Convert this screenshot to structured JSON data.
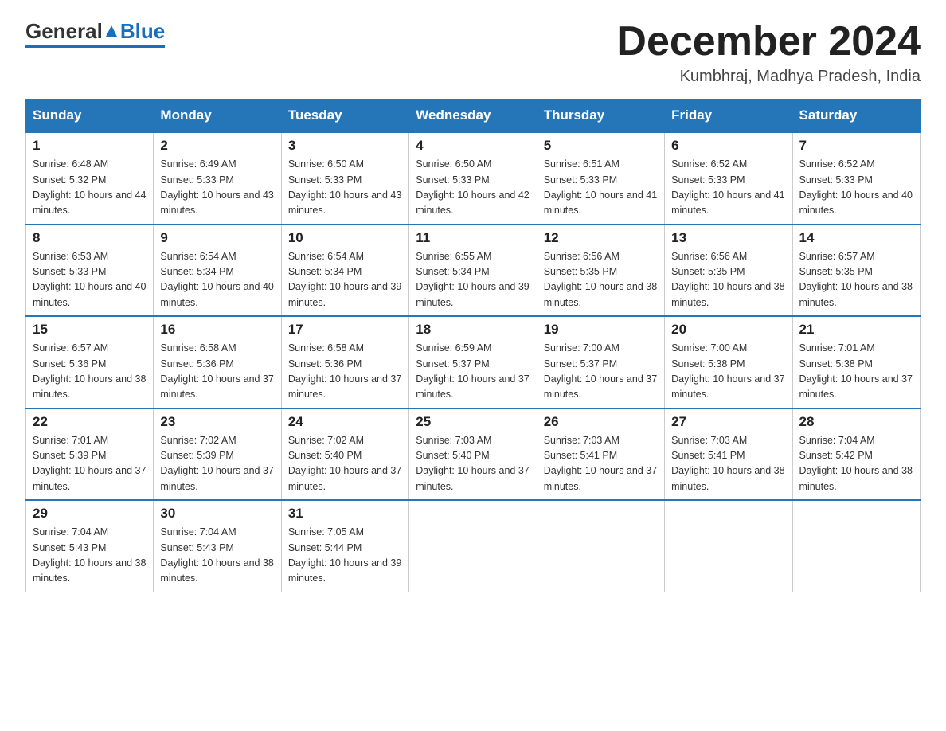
{
  "header": {
    "logo_general": "General",
    "logo_blue": "Blue",
    "title": "December 2024",
    "subtitle": "Kumbhraj, Madhya Pradesh, India"
  },
  "weekdays": [
    "Sunday",
    "Monday",
    "Tuesday",
    "Wednesday",
    "Thursday",
    "Friday",
    "Saturday"
  ],
  "weeks": [
    [
      {
        "day": "1",
        "sunrise": "6:48 AM",
        "sunset": "5:32 PM",
        "daylight": "10 hours and 44 minutes."
      },
      {
        "day": "2",
        "sunrise": "6:49 AM",
        "sunset": "5:33 PM",
        "daylight": "10 hours and 43 minutes."
      },
      {
        "day": "3",
        "sunrise": "6:50 AM",
        "sunset": "5:33 PM",
        "daylight": "10 hours and 43 minutes."
      },
      {
        "day": "4",
        "sunrise": "6:50 AM",
        "sunset": "5:33 PM",
        "daylight": "10 hours and 42 minutes."
      },
      {
        "day": "5",
        "sunrise": "6:51 AM",
        "sunset": "5:33 PM",
        "daylight": "10 hours and 41 minutes."
      },
      {
        "day": "6",
        "sunrise": "6:52 AM",
        "sunset": "5:33 PM",
        "daylight": "10 hours and 41 minutes."
      },
      {
        "day": "7",
        "sunrise": "6:52 AM",
        "sunset": "5:33 PM",
        "daylight": "10 hours and 40 minutes."
      }
    ],
    [
      {
        "day": "8",
        "sunrise": "6:53 AM",
        "sunset": "5:33 PM",
        "daylight": "10 hours and 40 minutes."
      },
      {
        "day": "9",
        "sunrise": "6:54 AM",
        "sunset": "5:34 PM",
        "daylight": "10 hours and 40 minutes."
      },
      {
        "day": "10",
        "sunrise": "6:54 AM",
        "sunset": "5:34 PM",
        "daylight": "10 hours and 39 minutes."
      },
      {
        "day": "11",
        "sunrise": "6:55 AM",
        "sunset": "5:34 PM",
        "daylight": "10 hours and 39 minutes."
      },
      {
        "day": "12",
        "sunrise": "6:56 AM",
        "sunset": "5:35 PM",
        "daylight": "10 hours and 38 minutes."
      },
      {
        "day": "13",
        "sunrise": "6:56 AM",
        "sunset": "5:35 PM",
        "daylight": "10 hours and 38 minutes."
      },
      {
        "day": "14",
        "sunrise": "6:57 AM",
        "sunset": "5:35 PM",
        "daylight": "10 hours and 38 minutes."
      }
    ],
    [
      {
        "day": "15",
        "sunrise": "6:57 AM",
        "sunset": "5:36 PM",
        "daylight": "10 hours and 38 minutes."
      },
      {
        "day": "16",
        "sunrise": "6:58 AM",
        "sunset": "5:36 PM",
        "daylight": "10 hours and 37 minutes."
      },
      {
        "day": "17",
        "sunrise": "6:58 AM",
        "sunset": "5:36 PM",
        "daylight": "10 hours and 37 minutes."
      },
      {
        "day": "18",
        "sunrise": "6:59 AM",
        "sunset": "5:37 PM",
        "daylight": "10 hours and 37 minutes."
      },
      {
        "day": "19",
        "sunrise": "7:00 AM",
        "sunset": "5:37 PM",
        "daylight": "10 hours and 37 minutes."
      },
      {
        "day": "20",
        "sunrise": "7:00 AM",
        "sunset": "5:38 PM",
        "daylight": "10 hours and 37 minutes."
      },
      {
        "day": "21",
        "sunrise": "7:01 AM",
        "sunset": "5:38 PM",
        "daylight": "10 hours and 37 minutes."
      }
    ],
    [
      {
        "day": "22",
        "sunrise": "7:01 AM",
        "sunset": "5:39 PM",
        "daylight": "10 hours and 37 minutes."
      },
      {
        "day": "23",
        "sunrise": "7:02 AM",
        "sunset": "5:39 PM",
        "daylight": "10 hours and 37 minutes."
      },
      {
        "day": "24",
        "sunrise": "7:02 AM",
        "sunset": "5:40 PM",
        "daylight": "10 hours and 37 minutes."
      },
      {
        "day": "25",
        "sunrise": "7:03 AM",
        "sunset": "5:40 PM",
        "daylight": "10 hours and 37 minutes."
      },
      {
        "day": "26",
        "sunrise": "7:03 AM",
        "sunset": "5:41 PM",
        "daylight": "10 hours and 37 minutes."
      },
      {
        "day": "27",
        "sunrise": "7:03 AM",
        "sunset": "5:41 PM",
        "daylight": "10 hours and 38 minutes."
      },
      {
        "day": "28",
        "sunrise": "7:04 AM",
        "sunset": "5:42 PM",
        "daylight": "10 hours and 38 minutes."
      }
    ],
    [
      {
        "day": "29",
        "sunrise": "7:04 AM",
        "sunset": "5:43 PM",
        "daylight": "10 hours and 38 minutes."
      },
      {
        "day": "30",
        "sunrise": "7:04 AM",
        "sunset": "5:43 PM",
        "daylight": "10 hours and 38 minutes."
      },
      {
        "day": "31",
        "sunrise": "7:05 AM",
        "sunset": "5:44 PM",
        "daylight": "10 hours and 39 minutes."
      },
      null,
      null,
      null,
      null
    ]
  ],
  "labels": {
    "sunrise_label": "Sunrise:",
    "sunset_label": "Sunset:",
    "daylight_label": "Daylight:"
  }
}
